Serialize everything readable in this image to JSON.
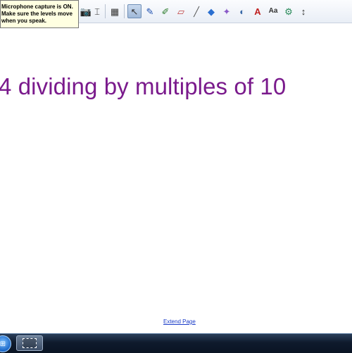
{
  "toolbar": {
    "icons": [
      "camera-icon",
      "screen-capture-icon",
      "table-icon",
      "select-arrow-icon",
      "pen-icon",
      "highlighter-icon",
      "eraser-icon",
      "line-icon",
      "fill-shape-icon",
      "magic-pen-icon",
      "fill-bucket-icon",
      "text-icon",
      "text-style-icon",
      "properties-icon",
      "more-icon"
    ],
    "glyphs": {
      "table": "▦",
      "select": "↖",
      "pen": "✎",
      "highlighter": "✐",
      "eraser": "▱",
      "line": "╱",
      "shape": "◆",
      "magic": "✦",
      "fill": "◐",
      "text": "A",
      "textstyle": "Aa",
      "properties": "⚙",
      "more": "↕"
    },
    "active_tool": "select-arrow-icon"
  },
  "mic_tooltip": {
    "text": "Microphone capture is ON.\nMake sure the levels move\nwhen you speak."
  },
  "page": {
    "title": "4 dividing by multiples of 10",
    "extend_link": "Extend Page"
  },
  "colors": {
    "title": "#7a1a8c",
    "link": "#1a3cc8",
    "tooltip_bg": "#ffffe1",
    "taskbar": "#0e1a2c"
  },
  "taskbar": {
    "start_icon": "windows-start-icon",
    "app_icon": "screen-capture-app-icon"
  }
}
